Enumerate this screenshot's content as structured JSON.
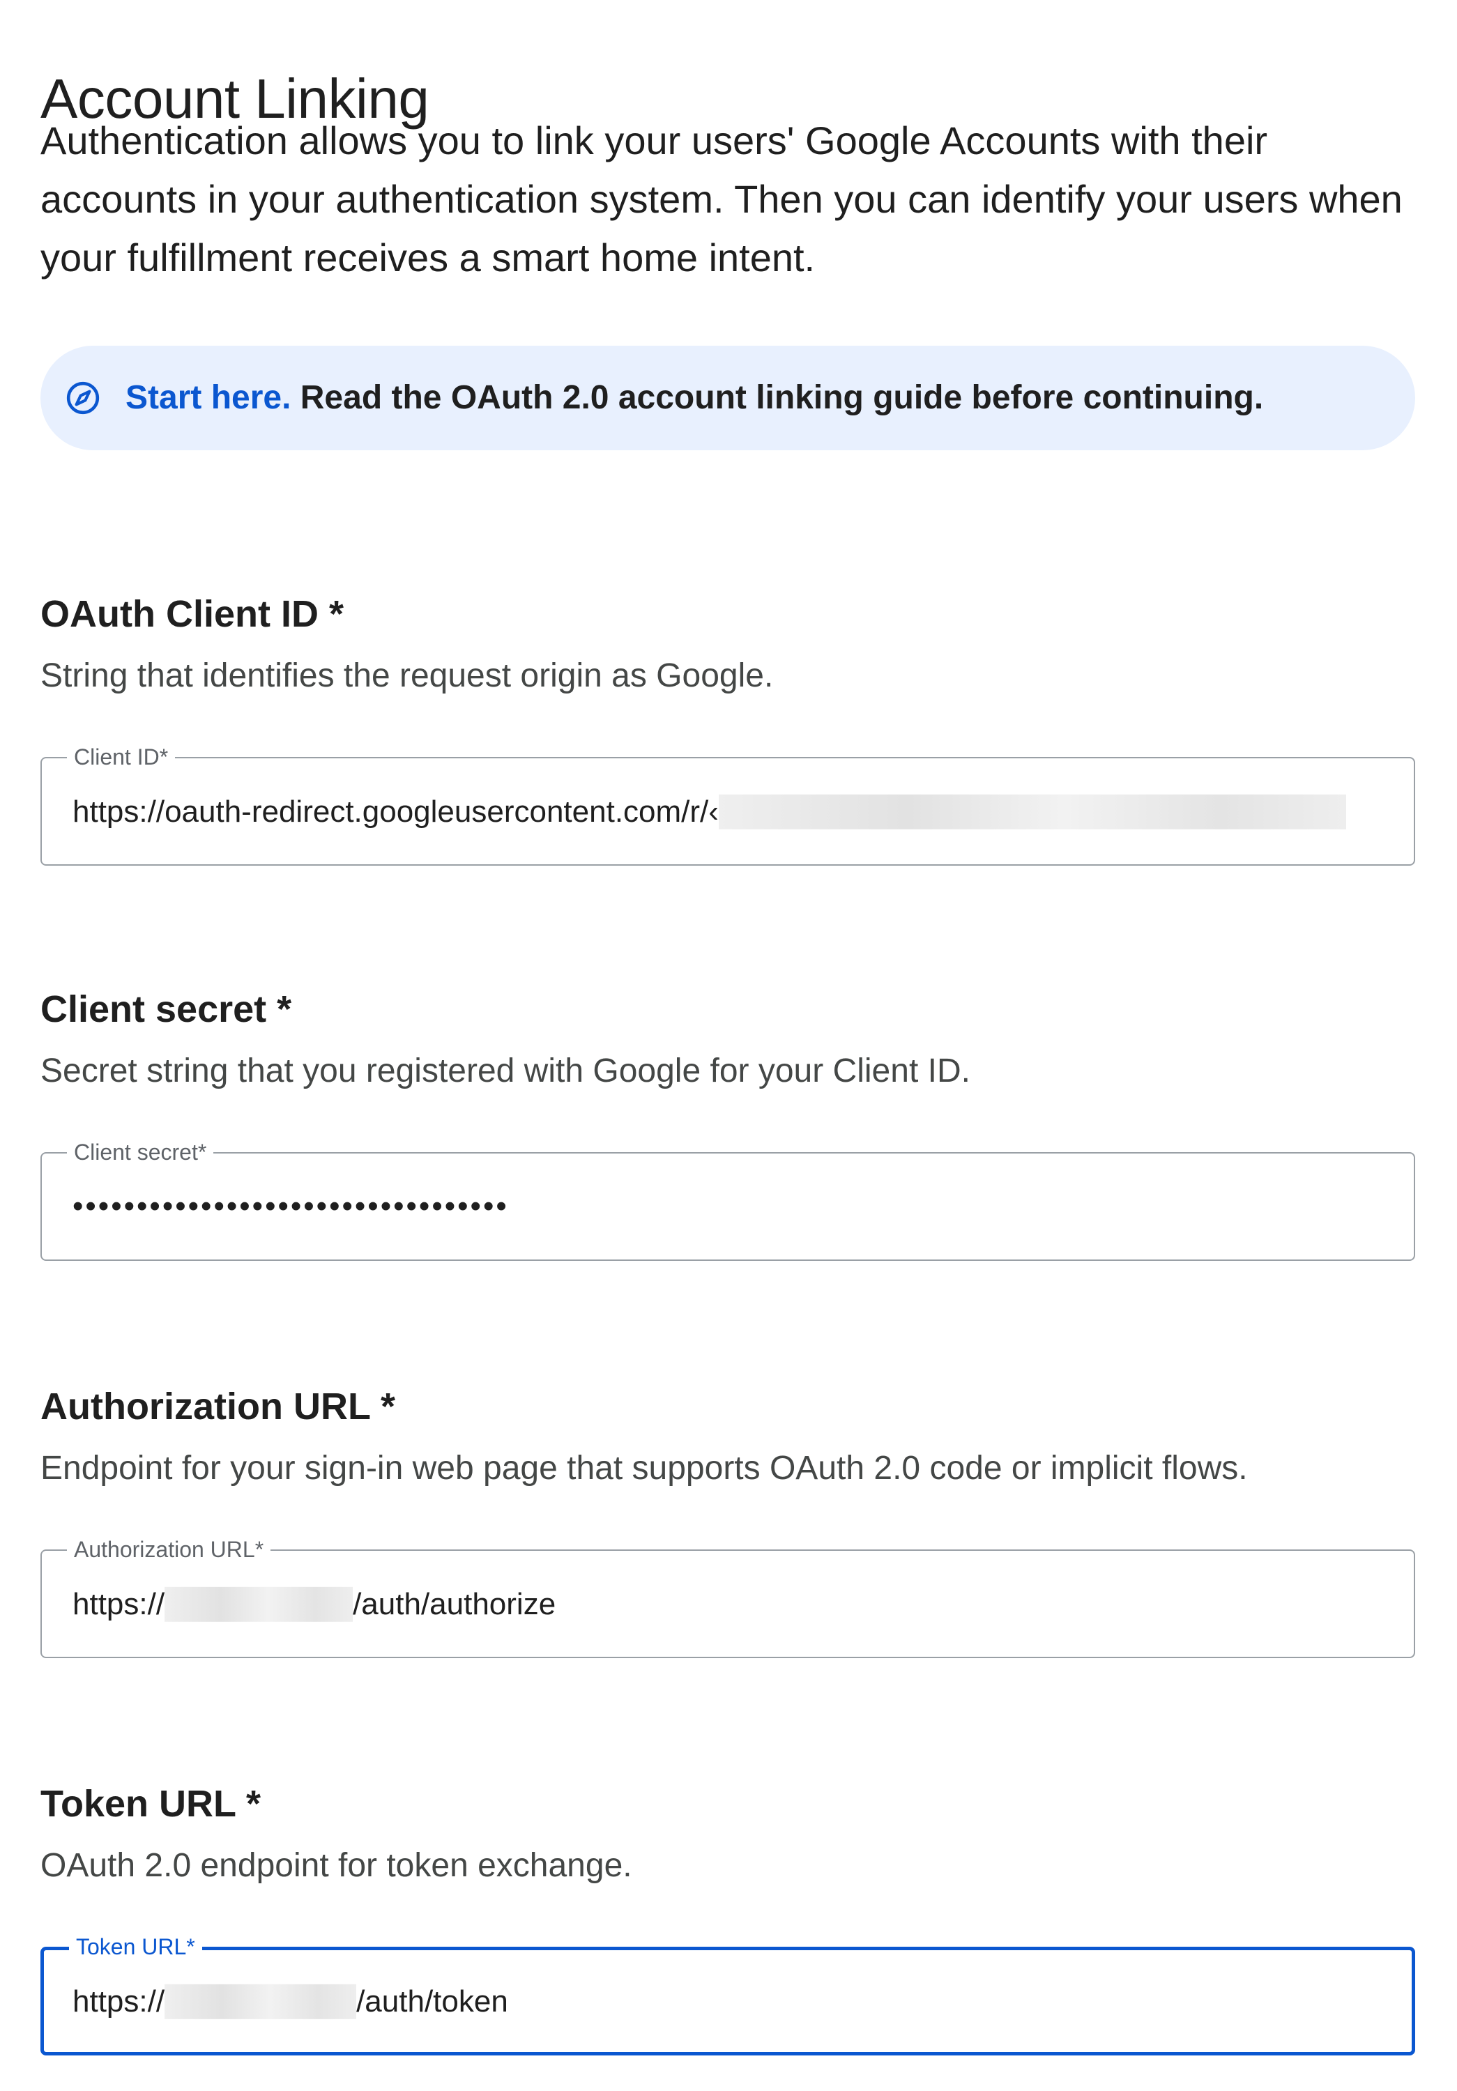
{
  "header": {
    "title": "Account Linking",
    "intro": "Authentication allows you to link your users' Google Accounts with their accounts in your authentication system. Then you can identify your users when your fulfillment receives a smart home intent."
  },
  "banner": {
    "icon": "compass-icon",
    "lead": "Start here.",
    "text": "Read the OAuth 2.0 account linking guide before continuing."
  },
  "sections": {
    "client_id": {
      "heading": "OAuth Client ID *",
      "description": "String that identifies the request origin as Google.",
      "field_label": "Client ID*",
      "value_prefix": "https://oauth-redirect.googleusercontent.com/r/‹"
    },
    "client_secret": {
      "heading": "Client secret *",
      "description": "Secret string that you registered with Google for your Client ID.",
      "field_label": "Client secret*",
      "value_masked": "••••••••••••••••••••••••••••••••••"
    },
    "authorization_url": {
      "heading": "Authorization URL *",
      "description": "Endpoint for your sign-in web page that supports OAuth 2.0 code or implicit flows.",
      "field_label": "Authorization URL*",
      "value_prefix": "https://",
      "value_suffix": "/auth/authorize"
    },
    "token_url": {
      "heading": "Token URL *",
      "description": "OAuth 2.0 endpoint for token exchange.",
      "field_label": "Token URL*",
      "value_prefix": "https://",
      "value_suffix": "/auth/token",
      "focused": true
    }
  },
  "colors": {
    "accent": "#0b57d0",
    "banner_bg": "#e8f0fe",
    "border": "#9aa0a6",
    "text": "#1f1f1f",
    "secondary_text": "#444746"
  }
}
